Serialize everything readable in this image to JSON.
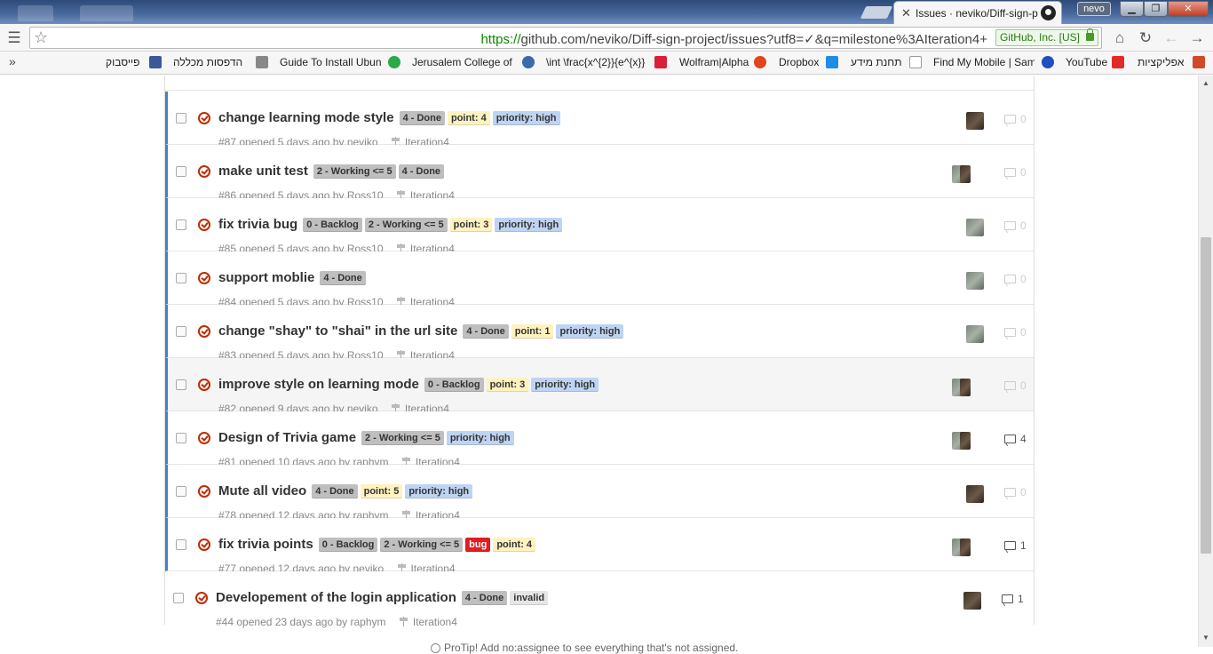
{
  "browser": {
    "tab_title": "Issues · neviko/Diff-sign-p",
    "user_badge": "nevo",
    "url_scheme": "https://",
    "url_rest": "github.com/neviko/Diff-sign-project/issues?utf8=✓&q=milestone%3AIteration4+",
    "ev_cert": "GitHub, Inc. [US]",
    "window_buttons": {
      "minimize": "▁",
      "maximize": "❐",
      "close": "✕"
    }
  },
  "bookmarks": [
    {
      "label": "פייסבוק",
      "icon_color": "#3b5998"
    },
    {
      "label": "הדפסות מכללה",
      "icon_color": "#888888"
    },
    {
      "label": "Guide To Install Ubun",
      "icon_color": "#2aa84a"
    },
    {
      "label": "Jerusalem College of",
      "icon_color": "#3a6aa8"
    },
    {
      "label": "\\int \\frac{x^{2}}{e^{x}}",
      "icon_color": "#d81e3a"
    },
    {
      "label": "Wolfram|Alpha",
      "icon_color": "#e0451d"
    },
    {
      "label": "Dropbox",
      "icon_color": "#1f8ce6"
    },
    {
      "label": "תחנת מידע",
      "icon_color": "#999999"
    },
    {
      "label": "Find My Mobile | Sam",
      "icon_color": "#1f4fbf"
    },
    {
      "label": "YouTube",
      "icon_color": "#e22a26"
    },
    {
      "label": "אפליקציות",
      "icon_color": "#d04a2a"
    }
  ],
  "label_styles": {
    "done": {
      "bg": "#bfbfbf",
      "fg": "#333333"
    },
    "working": {
      "bg": "#bfbfbf",
      "fg": "#333333"
    },
    "backlog": {
      "bg": "#bfbfbf",
      "fg": "#333333"
    },
    "point": {
      "bg": "#fef2c0",
      "fg": "#333333"
    },
    "priority": {
      "bg": "#bfd4f2",
      "fg": "#333333"
    },
    "bug": {
      "bg": "#e11d21",
      "fg": "#ffffff"
    },
    "invalid": {
      "bg": "#e6e6e6",
      "fg": "#333333"
    }
  },
  "issues": [
    {
      "title": "change learning mode style",
      "labels": [
        {
          "text": "4 - Done",
          "style": "done"
        },
        {
          "text": "point: 4",
          "style": "point"
        },
        {
          "text": "priority: high",
          "style": "priority"
        }
      ],
      "number": "#87",
      "opened": "opened 5 days ago by",
      "author": "neviko",
      "milestone": "Iteration4",
      "comments": "0",
      "avatars": [
        "a"
      ],
      "unread": true
    },
    {
      "title": "make unit test",
      "labels": [
        {
          "text": "2 - Working <= 5",
          "style": "working"
        },
        {
          "text": "4 - Done",
          "style": "done"
        }
      ],
      "number": "#86",
      "opened": "opened 5 days ago by",
      "author": "Ross10",
      "milestone": "Iteration4",
      "comments": "0",
      "avatars": [
        "b",
        "a"
      ],
      "unread": true
    },
    {
      "title": "fix trivia bug",
      "labels": [
        {
          "text": "0 - Backlog",
          "style": "backlog"
        },
        {
          "text": "2 - Working <= 5",
          "style": "working"
        },
        {
          "text": "point: 3",
          "style": "point"
        },
        {
          "text": "priority: high",
          "style": "priority"
        }
      ],
      "number": "#85",
      "opened": "opened 5 days ago by",
      "author": "Ross10",
      "milestone": "Iteration4",
      "comments": "0",
      "avatars": [
        "b"
      ],
      "unread": true
    },
    {
      "title": "support moblie",
      "labels": [
        {
          "text": "4 - Done",
          "style": "done"
        }
      ],
      "number": "#84",
      "opened": "opened 5 days ago by",
      "author": "Ross10",
      "milestone": "Iteration4",
      "comments": "0",
      "avatars": [
        "b"
      ],
      "unread": true
    },
    {
      "title": "change \"shay\" to \"shai\" in the url site",
      "labels": [
        {
          "text": "4 - Done",
          "style": "done"
        },
        {
          "text": "point: 1",
          "style": "point"
        },
        {
          "text": "priority: high",
          "style": "priority"
        }
      ],
      "number": "#83",
      "opened": "opened 5 days ago by",
      "author": "Ross10",
      "milestone": "Iteration4",
      "comments": "0",
      "avatars": [
        "b"
      ],
      "unread": true
    },
    {
      "title": "improve style on learning mode",
      "labels": [
        {
          "text": "0 - Backlog",
          "style": "backlog"
        },
        {
          "text": "point: 3",
          "style": "point"
        },
        {
          "text": "priority: high",
          "style": "priority"
        }
      ],
      "number": "#82",
      "opened": "opened 9 days ago by",
      "author": "neviko",
      "milestone": "Iteration4",
      "comments": "0",
      "avatars": [
        "b",
        "a"
      ],
      "unread": true,
      "hover": true
    },
    {
      "title": "Design of Trivia game",
      "labels": [
        {
          "text": "2 - Working <= 5",
          "style": "working"
        },
        {
          "text": "priority: high",
          "style": "priority"
        }
      ],
      "number": "#81",
      "opened": "opened 10 days ago by",
      "author": "raphym",
      "milestone": "Iteration4",
      "comments": "4",
      "avatars": [
        "b",
        "a"
      ],
      "unread": true
    },
    {
      "title": "Mute all video",
      "labels": [
        {
          "text": "4 - Done",
          "style": "done"
        },
        {
          "text": "point: 5",
          "style": "point"
        },
        {
          "text": "priority: high",
          "style": "priority"
        }
      ],
      "number": "#78",
      "opened": "opened 12 days ago by",
      "author": "raphym",
      "milestone": "Iteration4",
      "comments": "0",
      "avatars": [
        "a"
      ],
      "unread": true
    },
    {
      "title": "fix trivia points",
      "labels": [
        {
          "text": "0 - Backlog",
          "style": "backlog"
        },
        {
          "text": "2 - Working <= 5",
          "style": "working"
        },
        {
          "text": "bug",
          "style": "bug"
        },
        {
          "text": "point: 4",
          "style": "point"
        }
      ],
      "number": "#77",
      "opened": "opened 12 days ago by",
      "author": "neviko",
      "milestone": "Iteration4",
      "comments": "1",
      "avatars": [
        "b",
        "a"
      ],
      "unread": true
    },
    {
      "title": "Developement of the login application",
      "labels": [
        {
          "text": "4 - Done",
          "style": "done"
        },
        {
          "text": "invalid",
          "style": "invalid"
        }
      ],
      "number": "#44",
      "opened": "opened 23 days ago by",
      "author": "raphym",
      "milestone": "Iteration4",
      "comments": "1",
      "avatars": [
        "a"
      ],
      "unread": false
    }
  ],
  "footer_tip": "ProTip! Add no:assignee to see everything that's not assigned."
}
